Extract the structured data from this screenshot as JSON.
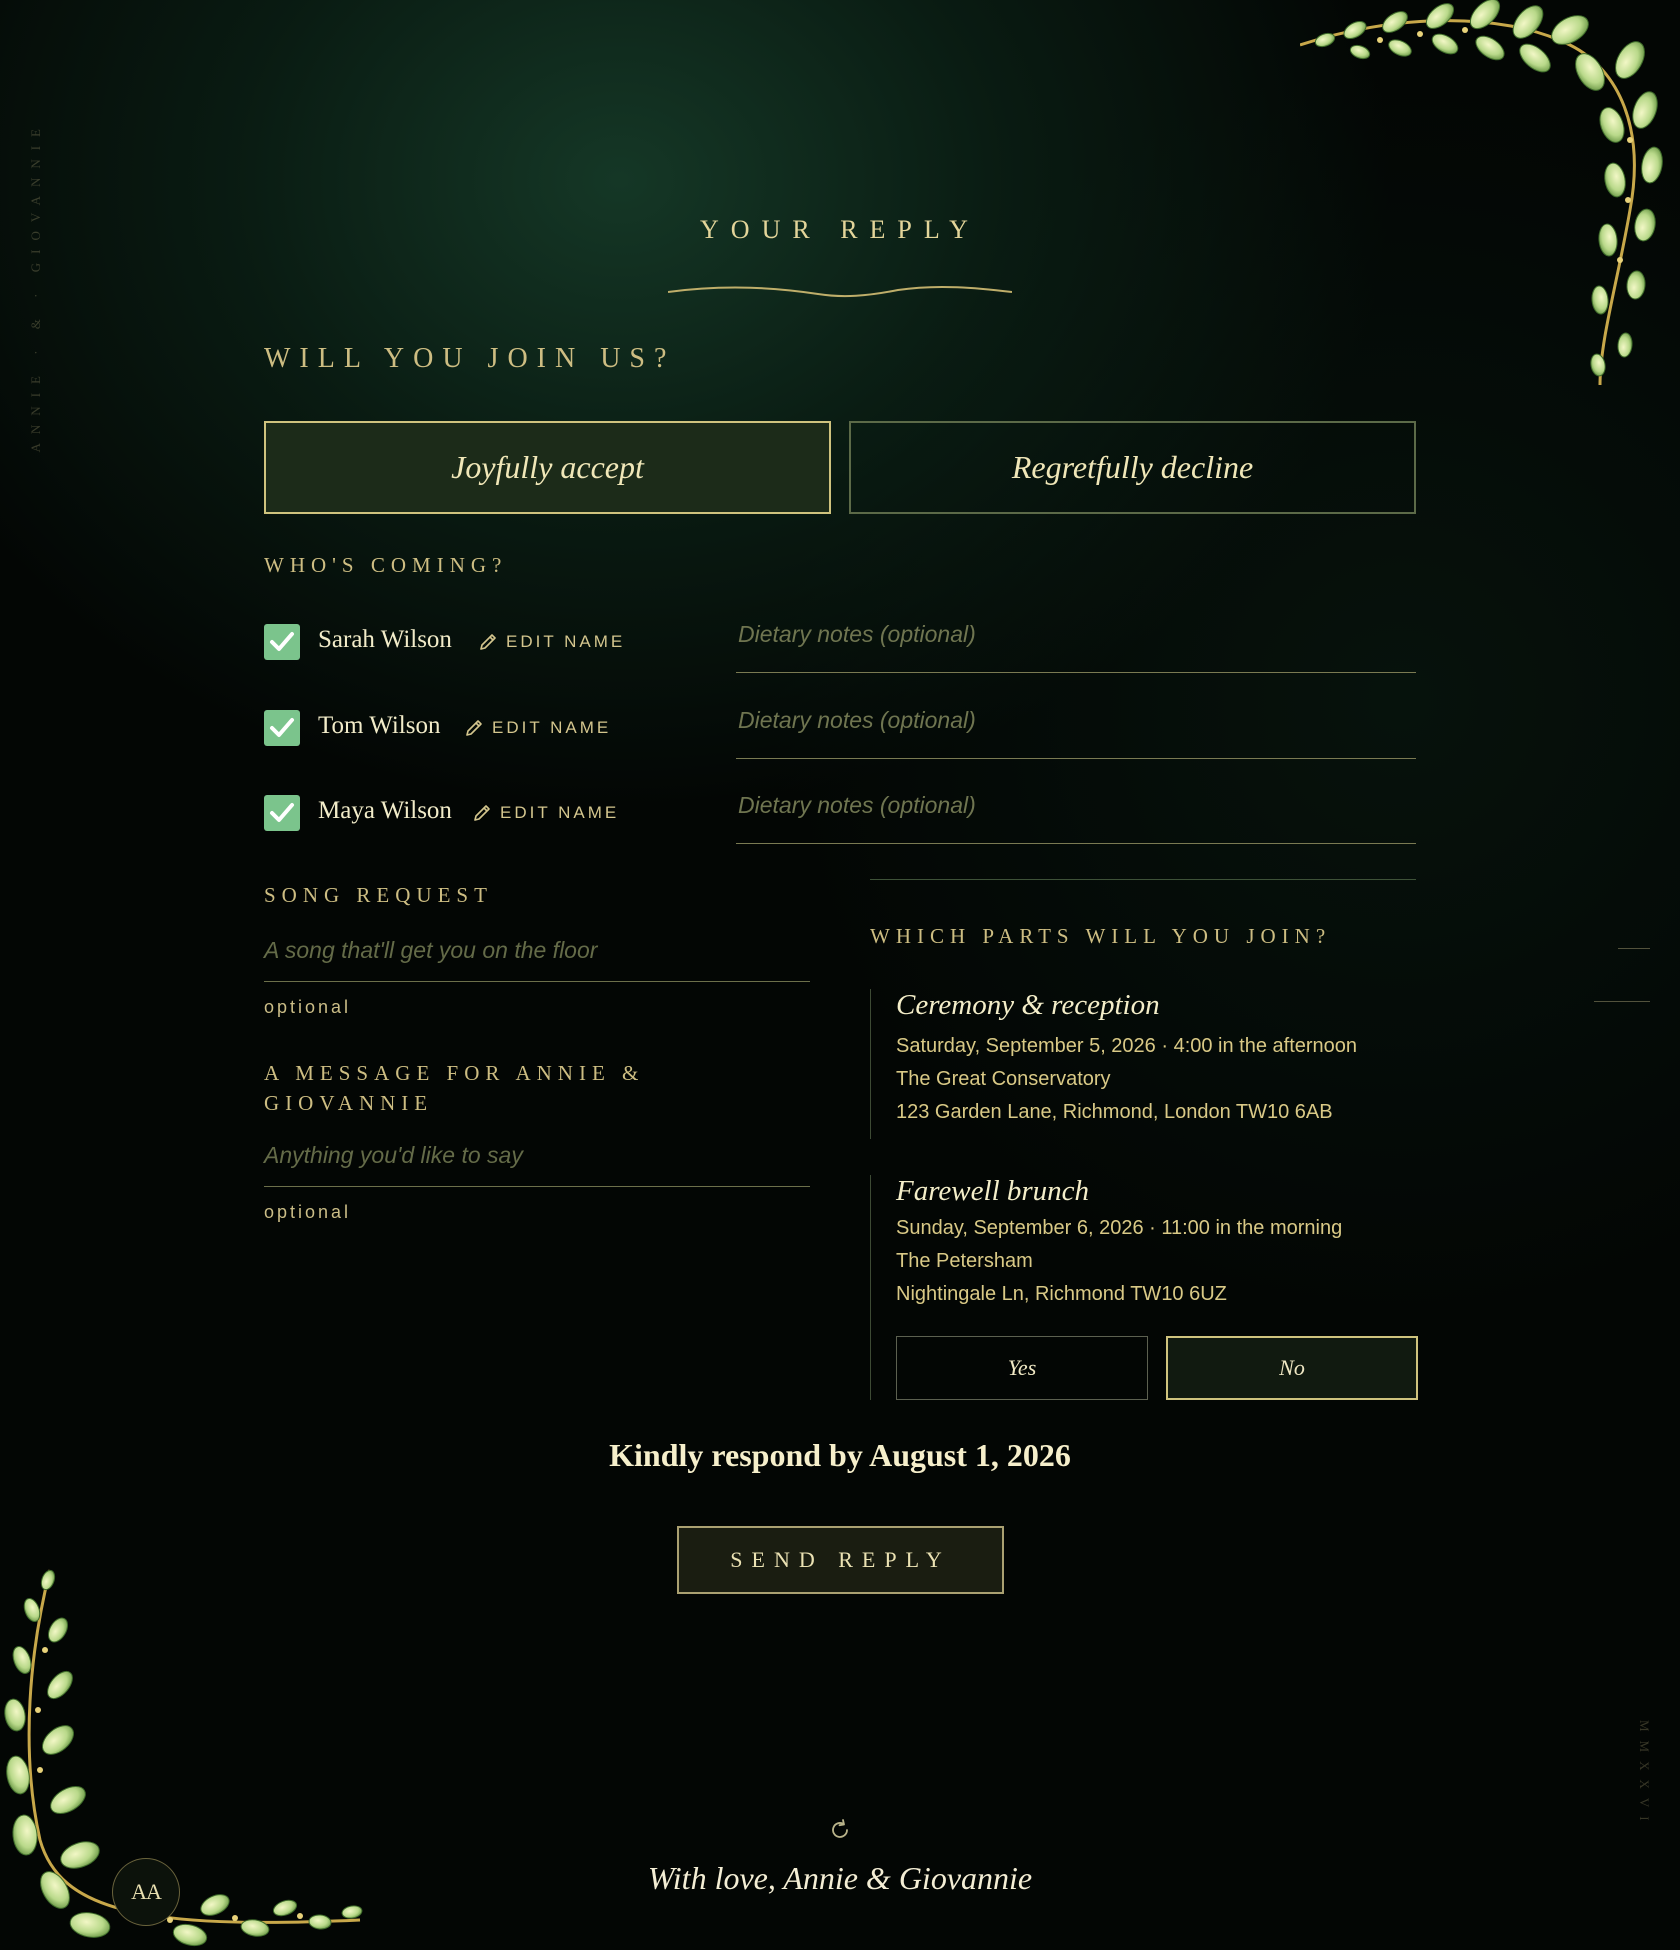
{
  "side": {
    "left_text": "ANNIE · & · GIOVANNIE",
    "right_text": "MMXXVI"
  },
  "header": {
    "title": "YOUR REPLY"
  },
  "attendance": {
    "question": "WILL YOU JOIN US?",
    "accept_label": "Joyfully accept",
    "decline_label": "Regretfully decline",
    "selected": "accept"
  },
  "guests": {
    "heading": "WHO'S COMING?",
    "edit_label": "EDIT NAME",
    "dietary_placeholder": "Dietary notes (optional)",
    "list": [
      {
        "name": "Sarah Wilson",
        "checked": true
      },
      {
        "name": "Tom Wilson",
        "checked": true
      },
      {
        "name": "Maya Wilson",
        "checked": true
      }
    ]
  },
  "song": {
    "heading": "SONG REQUEST",
    "placeholder": "A song that'll get you on the floor",
    "hint": "optional"
  },
  "message": {
    "heading_line1": "A MESSAGE FOR ANNIE &",
    "heading_line2": "GIOVANNIE",
    "placeholder": "Anything you'd like to say",
    "hint": "optional"
  },
  "parts": {
    "heading": "WHICH PARTS WILL YOU JOIN?",
    "events": [
      {
        "title": "Ceremony & reception",
        "when": "Saturday, September 5, 2026 · 4:00 in the afternoon",
        "venue": "The Great Conservatory",
        "address": "123 Garden Lane, Richmond, London TW10 6AB"
      },
      {
        "title": "Farewell brunch",
        "when": "Sunday, September 6, 2026 · 11:00 in the morning",
        "venue": "The Petersham",
        "address": "Nightingale Ln, Richmond TW10 6UZ"
      }
    ],
    "yes_label": "Yes",
    "no_label": "No",
    "brunch_selected": "No"
  },
  "footer": {
    "deadline": "Kindly respond by August 1, 2026",
    "send_label": "SEND REPLY",
    "signature": "With love, Annie & Giovannie",
    "monogram": "AA"
  },
  "colors": {
    "accent_gold": "#d8c98a",
    "check_green": "#7bc48c",
    "background": "#030604"
  },
  "icons": [
    "pencil-icon",
    "checkmark-icon",
    "refresh-icon",
    "leaf-garland"
  ]
}
